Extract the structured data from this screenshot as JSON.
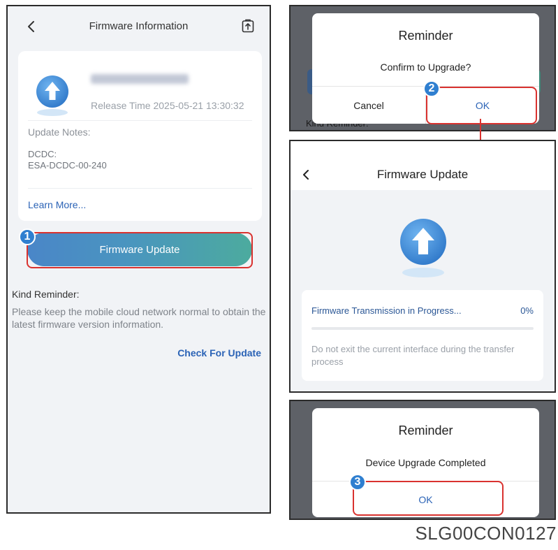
{
  "left_screen": {
    "title": "Firmware Information",
    "release_time": "Release Time 2025-05-21 13:30:32",
    "update_notes_label": "Update Notes:",
    "update_notes_lines": [
      "DCDC:",
      "ESA-DCDC-00-240"
    ],
    "learn_more": "Learn More...",
    "update_button": "Firmware Update",
    "kind_reminder_title": "Kind Reminder:",
    "kind_reminder_body": "Please keep the mobile cloud network normal to obtain the latest firmware version information.",
    "check_for_update": "Check For Update"
  },
  "confirm_dialog": {
    "title": "Reminder",
    "message": "Confirm to Upgrade?",
    "cancel_label": "Cancel",
    "ok_label": "OK",
    "background_text": "Kind Reminder:"
  },
  "update_screen": {
    "title": "Firmware Update",
    "progress_label": "Firmware Transmission in Progress...",
    "progress_percent_text": "0%",
    "progress_value": 0,
    "note": "Do not exit the current interface during the transfer process"
  },
  "complete_dialog": {
    "title": "Reminder",
    "message": "Device Upgrade Completed",
    "ok_label": "OK"
  },
  "step_badges": [
    "1",
    "2",
    "3"
  ],
  "figure_code": "SLG00CON0127",
  "colors": {
    "accent_blue": "#2b63b6",
    "highlight_red": "#d9322f",
    "badge_blue": "#2f7fd0",
    "gradient_start": "#4a86c8",
    "gradient_end": "#4cab9e",
    "progress_fill": "#3a7bd5"
  },
  "icons": {
    "back": "chevron-left-icon",
    "export": "export-icon",
    "upgrade": "upgrade-arrow-icon"
  }
}
